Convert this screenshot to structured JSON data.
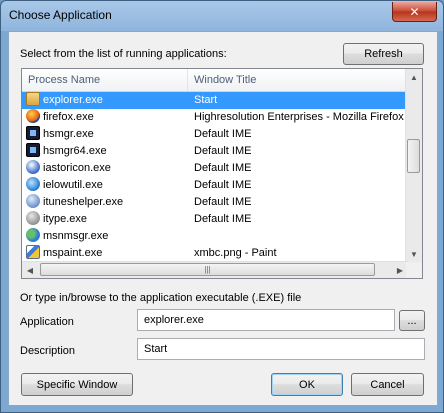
{
  "window": {
    "title": "Choose Application",
    "close_glyph": "✕"
  },
  "intro_label": "Select from the list of running applications:",
  "refresh_button": "Refresh",
  "columns": [
    "Process Name",
    "Window Title"
  ],
  "processes": [
    {
      "name": "explorer.exe",
      "title": "Start",
      "icon": "explorer-icon"
    },
    {
      "name": "firefox.exe",
      "title": "Highresolution Enterprises - Mozilla Firefox",
      "icon": "firefox-icon"
    },
    {
      "name": "hsmgr.exe",
      "title": "Default IME",
      "icon": "hsmgr-icon"
    },
    {
      "name": "hsmgr64.exe",
      "title": "Default IME",
      "icon": "hsmgr64-icon"
    },
    {
      "name": "iastoricon.exe",
      "title": "Default IME",
      "icon": "iastor-icon"
    },
    {
      "name": "ielowutil.exe",
      "title": "Default IME",
      "icon": "internet-explorer-icon"
    },
    {
      "name": "ituneshelper.exe",
      "title": "Default IME",
      "icon": "itunes-icon"
    },
    {
      "name": "itype.exe",
      "title": "Default IME",
      "icon": "itype-icon"
    },
    {
      "name": "msnmsgr.exe",
      "title": "",
      "icon": "msn-messenger-icon"
    },
    {
      "name": "mspaint.exe",
      "title": "xmbc.png - Paint",
      "icon": "paint-icon"
    }
  ],
  "selected_index": 0,
  "browse_label": "Or type in/browse to the application executable (.EXE) file",
  "application": {
    "label": "Application",
    "value": "explorer.exe",
    "browse_button": "..."
  },
  "description": {
    "label": "Description",
    "value": "Start"
  },
  "buttons": {
    "specific_window": "Specific Window",
    "ok": "OK",
    "cancel": "Cancel"
  }
}
